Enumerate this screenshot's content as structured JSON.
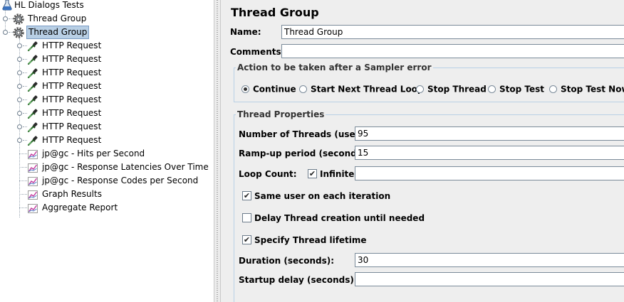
{
  "tree": {
    "root_label": "HL Dialogs Tests",
    "items": [
      {
        "label": "Thread Group",
        "icon": "gear-icon",
        "selected": false
      },
      {
        "label": "Thread Group",
        "icon": "gear-icon",
        "selected": true
      },
      {
        "label": "HTTP Request",
        "icon": "pipette-icon"
      },
      {
        "label": "HTTP Request",
        "icon": "pipette-icon"
      },
      {
        "label": "HTTP Request",
        "icon": "pipette-icon"
      },
      {
        "label": "HTTP Request",
        "icon": "pipette-icon"
      },
      {
        "label": "HTTP Request",
        "icon": "pipette-icon"
      },
      {
        "label": "HTTP Request",
        "icon": "pipette-icon"
      },
      {
        "label": "HTTP Request",
        "icon": "pipette-icon"
      },
      {
        "label": "HTTP Request",
        "icon": "pipette-icon"
      },
      {
        "label": "jp@gc - Hits per Second",
        "icon": "graph-listener-icon"
      },
      {
        "label": "jp@gc - Response Latencies Over Time",
        "icon": "graph-listener-icon"
      },
      {
        "label": "jp@gc - Response Codes per Second",
        "icon": "graph-listener-icon"
      },
      {
        "label": "Graph Results",
        "icon": "graph-listener-icon"
      },
      {
        "label": "Aggregate Report",
        "icon": "graph-listener-icon"
      }
    ]
  },
  "panel": {
    "title": "Thread Group",
    "name_label": "Name:",
    "name_value": "Thread Group",
    "comments_label": "Comments:",
    "comments_value": "",
    "sampler_error": {
      "legend": "Action to be taken after a Sampler error",
      "options": [
        {
          "label": "Continue",
          "selected": true
        },
        {
          "label": "Start Next Thread Loop",
          "selected": false
        },
        {
          "label": "Stop Thread",
          "selected": false
        },
        {
          "label": "Stop Test",
          "selected": false
        },
        {
          "label": "Stop Test Now",
          "selected": false
        }
      ]
    },
    "thread_props": {
      "legend": "Thread Properties",
      "threads_label": "Number of Threads (users):",
      "threads_value": "95",
      "rampup_label": "Ramp-up period (seconds):",
      "rampup_value": "15",
      "loop_label": "Loop Count:",
      "infinite_label": "Infinite",
      "infinite_checked": true,
      "loop_value": "",
      "same_user_label": "Same user on each iteration",
      "same_user_checked": true,
      "delay_label": "Delay Thread creation until needed",
      "delay_checked": false,
      "lifetime_label": "Specify Thread lifetime",
      "lifetime_checked": true,
      "duration_label": "Duration (seconds):",
      "duration_value": "30",
      "startup_label": "Startup delay (seconds):",
      "startup_value": ""
    }
  }
}
